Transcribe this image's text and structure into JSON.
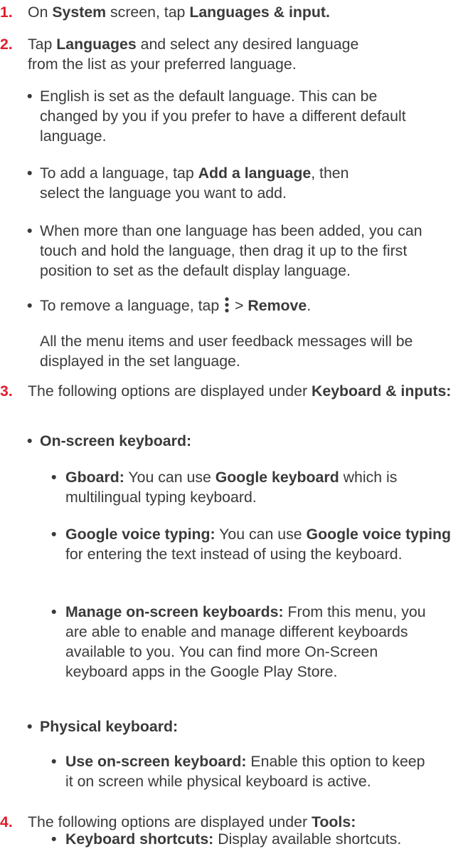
{
  "steps": {
    "s1": {
      "num": "1.",
      "t1": "On ",
      "b1": "System",
      "t2": " screen, tap ",
      "b2": "Languages & input."
    },
    "s2": {
      "num": "2.",
      "t1": "Tap ",
      "b1": "Languages",
      "t2": " and select any desired language from the list as your preferred language."
    },
    "s3": {
      "num": "3.",
      "t1": "The following options are displayed under ",
      "b1": "Keyboard & inputs:"
    },
    "s4": {
      "num": "4.",
      "t1": "The following options are displayed under ",
      "b1": "Tools:"
    }
  },
  "languages": {
    "default_note": "English is set as the default language. This can be changed by you if you prefer to have a different default language.",
    "add": {
      "t1": "To add a language, tap ",
      "b1": "Add a language",
      "t2": ", then select the language you want to add."
    },
    "drag_note": "When more than one language has been added, you can touch and hold the language, then drag it up to the first position to set as the default display language.",
    "remove": {
      "t1": "To remove a language, tap ",
      "t2": " > ",
      "b1": "Remove",
      "t3": ".",
      "icon": "more-vert-icon"
    },
    "display_note": "All the menu items and user feedback messages will be displayed in the set language."
  },
  "keyboard": {
    "onscreen": {
      "heading": "On-screen keyboard:",
      "gboard": {
        "b1": "Gboard:",
        "t1": " You can use ",
        "b2": "Google keyboard",
        "t2": " which is multilingual typing keyboard."
      },
      "voice": {
        "b1": "Google voice typing:",
        "t1": " You can use ",
        "b2": "Google voice typing",
        "t2": " for entering the text instead of using the keyboard."
      },
      "manage": {
        "b1": "Manage on-screen keyboards:",
        "t1": " From this menu, you are able to enable and manage different keyboards available to you. You can find more On-Screen keyboard apps in the Google Play Store."
      }
    },
    "physical": {
      "heading": "Physical keyboard:",
      "use_onscreen": {
        "b1": "Use on-screen keyboard:",
        "t1": " Enable this option to keep it on screen while physical keyboard is active."
      },
      "shortcuts": {
        "b1": "Keyboard shortcuts:",
        "t1": " Display available shortcuts."
      }
    }
  },
  "bullet_char": "•",
  "colors": {
    "step_number": "#e11d2d",
    "body_text": "#3a3a3a"
  }
}
